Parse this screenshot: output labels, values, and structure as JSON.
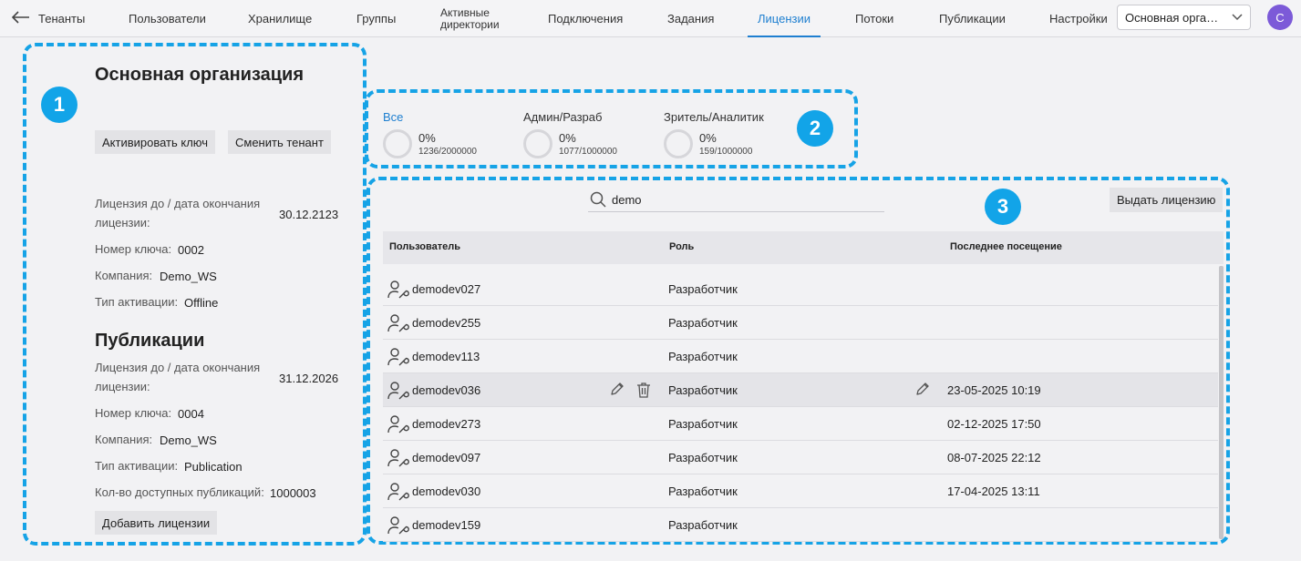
{
  "nav": {
    "tabs": [
      {
        "label": "Тенанты"
      },
      {
        "label": "Пользователи"
      },
      {
        "label": "Хранилище"
      },
      {
        "label": "Группы"
      },
      {
        "label": "Активные директории"
      },
      {
        "label": "Подключения"
      },
      {
        "label": "Задания"
      },
      {
        "label": "Лицензии"
      },
      {
        "label": "Потоки"
      },
      {
        "label": "Публикации"
      },
      {
        "label": "Настройки"
      }
    ],
    "active_tab": "Лицензии",
    "org_select": "Основная организация",
    "avatar_letter": "С"
  },
  "callouts": [
    "1",
    "2",
    "3"
  ],
  "left_panel": {
    "org_title": "Основная организация",
    "activate_button": "Активировать ключ",
    "switch_tenant_button": "Сменить тенант",
    "main_license": {
      "expiry_label": "Лицензия до / дата окончания лицензии:",
      "expiry_value": "30.12.2123",
      "key_label": "Номер ключа:",
      "key_value": "0002",
      "company_label": "Компания:",
      "company_value": "Demo_WS",
      "activation_label": "Тип активации:",
      "activation_value": "Offline"
    },
    "publications_title": "Публикации",
    "publications_license": {
      "expiry_label": "Лицензия до / дата окончания лицензии:",
      "expiry_value": "31.12.2026",
      "key_label": "Номер ключа:",
      "key_value": "0004",
      "company_label": "Компания:",
      "company_value": "Demo_WS",
      "activation_label": "Тип активации:",
      "activation_value": "Publication",
      "available_label": "Кол-во доступных публикаций:",
      "available_value": "1000003"
    },
    "add_licenses_button": "Добавить лицензии"
  },
  "stats": [
    {
      "title": "Все",
      "percent": "0%",
      "count": "1236/2000000",
      "active": true
    },
    {
      "title": "Админ/Разраб",
      "percent": "0%",
      "count": "1077/1000000",
      "active": false
    },
    {
      "title": "Зритель/Аналитик",
      "percent": "0%",
      "count": "159/1000000",
      "active": false
    }
  ],
  "users_panel": {
    "search_value": "demo",
    "issue_button": "Выдать лицензию",
    "columns": [
      "Пользователь",
      "Роль",
      "Последнее посещение"
    ],
    "rows": [
      {
        "user": "demodev027",
        "role": "Разработчик",
        "last_visit": ""
      },
      {
        "user": "demodev255",
        "role": "Разработчик",
        "last_visit": ""
      },
      {
        "user": "demodev113",
        "role": "Разработчик",
        "last_visit": ""
      },
      {
        "user": "demodev036",
        "role": "Разработчик",
        "last_visit": "23-05-2025 10:19"
      },
      {
        "user": "demodev273",
        "role": "Разработчик",
        "last_visit": "02-12-2025 17:50"
      },
      {
        "user": "demodev097",
        "role": "Разработчик",
        "last_visit": "08-07-2025 22:12"
      },
      {
        "user": "demodev030",
        "role": "Разработчик",
        "last_visit": "17-04-2025 13:11"
      },
      {
        "user": "demodev159",
        "role": "Разработчик",
        "last_visit": ""
      }
    ],
    "hovered_row": "demodev036"
  },
  "icons": [
    "back-arrow-icon",
    "chevron-down-icon",
    "search-icon",
    "user-wrench-icon",
    "pencil-icon",
    "trash-icon"
  ],
  "colors": {
    "accent": "#1e7fd0",
    "callout": "#12a4e8",
    "avatar": "#7c5ad8"
  }
}
